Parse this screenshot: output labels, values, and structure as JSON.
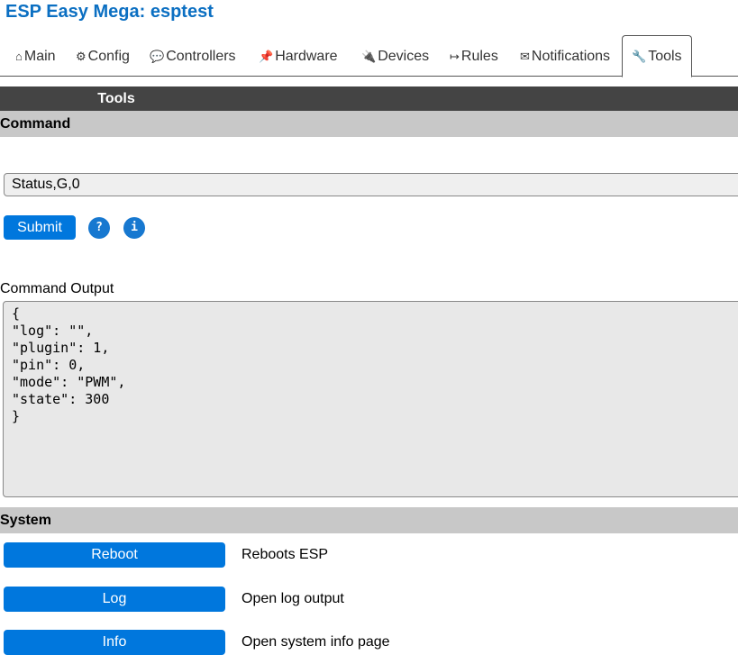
{
  "title": "ESP Easy Mega: esptest",
  "tabs": [
    {
      "icon": "⌂",
      "label": "Main"
    },
    {
      "icon": "⚙",
      "label": "Config"
    },
    {
      "icon": "💬",
      "label": "Controllers"
    },
    {
      "icon": "📌",
      "label": "Hardware"
    },
    {
      "icon": "🔌",
      "label": "Devices"
    },
    {
      "icon": "↦",
      "label": "Rules"
    },
    {
      "icon": "✉",
      "label": "Notifications"
    },
    {
      "icon": "🔧",
      "label": "Tools"
    }
  ],
  "page_header": "Tools",
  "command": {
    "header": "Command",
    "value": "Status,G,0",
    "submit": "Submit",
    "help": "?",
    "info": "i",
    "output_label": "Command Output",
    "output": "{\n\"log\": \"\",\n\"plugin\": 1,\n\"pin\": 0,\n\"mode\": \"PWM\",\n\"state\": 300\n}"
  },
  "system": {
    "header": "System",
    "items": [
      {
        "label": "Reboot",
        "desc": "Reboots ESP"
      },
      {
        "label": "Log",
        "desc": "Open log output"
      },
      {
        "label": "Info",
        "desc": "Open system info page"
      }
    ]
  },
  "colors": {
    "accent": "#0077dd",
    "title": "#0b6fc2"
  }
}
